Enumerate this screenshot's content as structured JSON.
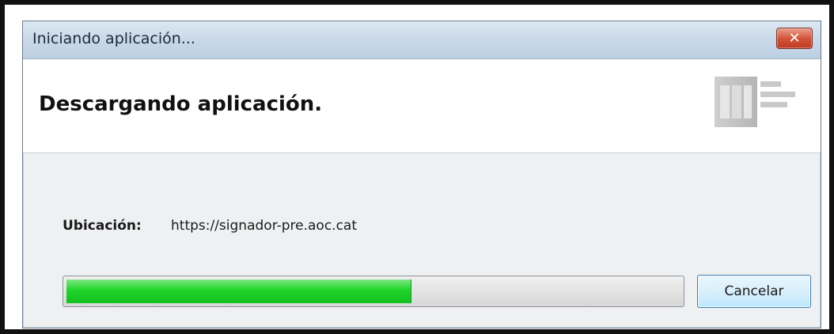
{
  "window": {
    "title": "Iniciando aplicación...",
    "close_symbol": "✕"
  },
  "header": {
    "heading": "Descargando aplicación.",
    "logo_icon": "aoc-logo-icon"
  },
  "location": {
    "label": "Ubicación:",
    "value": "https://signador-pre.aoc.cat"
  },
  "progress": {
    "fraction": 0.56,
    "color": "#1fd42a"
  },
  "actions": {
    "cancel_label": "Cancelar"
  }
}
